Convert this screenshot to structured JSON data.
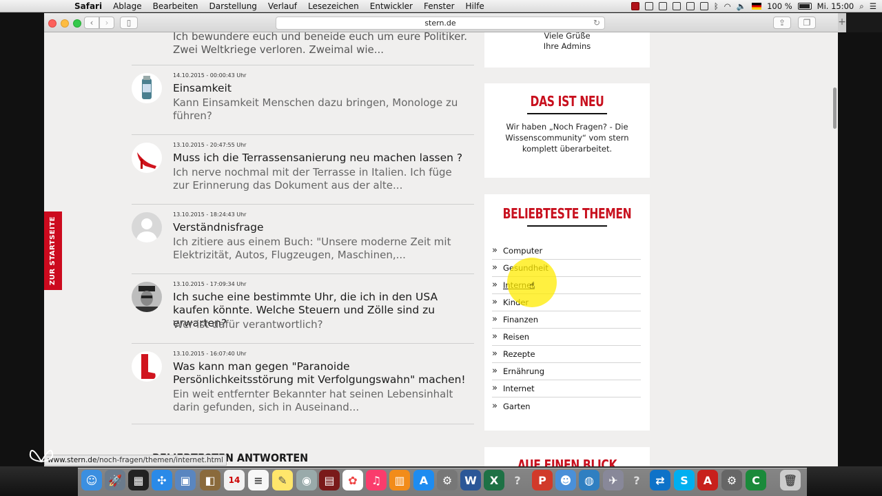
{
  "menubar": {
    "app": "Safari",
    "items": [
      "Ablage",
      "Bearbeiten",
      "Darstellung",
      "Verlauf",
      "Lesezeichen",
      "Entwickler",
      "Fenster",
      "Hilfe"
    ],
    "battery": "100 %",
    "clock": "Mi. 15:00"
  },
  "browser": {
    "url": "stern.de",
    "status_url_prefix": "www.stern.de",
    "status_url_path": "/noch-fragen/themen/internet.html"
  },
  "page": {
    "side_tab": "ZUR STARTSEITE",
    "prev_question_text": "Ich bewundere euch und beneide euch um eure Politiker. Zwei Weltkriege verloren. Zweimal wie...",
    "questions": [
      {
        "meta": "14.10.2015 - 00:00:43 Uhr",
        "title": "Einsamkeit",
        "text": "Kann Einsamkeit Menschen dazu bringen, Monologe zu führen?"
      },
      {
        "meta": "13.10.2015 - 20:47:55 Uhr",
        "title": "Muss ich die Terrassensanierung neu machen lassen ?",
        "text": "Ich nerve nochmal mit der Terrasse in Italien. Ich füge zur Erinnerung das Dokument aus der alte..."
      },
      {
        "meta": "13.10.2015 - 18:24:43 Uhr",
        "title": "Verständnisfrage",
        "text": "Ich zitiere aus einem Buch: \"Unsere moderne Zeit mit Elektrizität, Autos, Flugzeugen, Maschinen,..."
      },
      {
        "meta": "13.10.2015 - 17:09:34 Uhr",
        "title": "Ich suche eine bestimmte Uhr, die ich in den USA kaufen könnte. Welche Steuern und Zölle sind zu erwarten?",
        "text": "Wer ist dafür verantwortlich?"
      },
      {
        "meta": "13.10.2015 - 16:07:40 Uhr",
        "title": "Was kann man gegen \"Paranoide Persönlichkeitsstörung mit Verfolgungswahn\" machen!",
        "text": "Ein weit entfernter Bekannter hat seinen Lebensinhalt darin gefunden, sich in Auseinand..."
      }
    ],
    "admins_box": {
      "line1": "Viele Grüße",
      "line2": "Ihre Admins"
    },
    "neu_box": {
      "heading": "DAS IST NEU",
      "text": "Wir haben „Noch Fragen? - Die Wissenscommunity“ vom stern komplett überarbeitet."
    },
    "themen_box": {
      "heading": "BELIEBTESTE THEMEN",
      "topics": [
        "Computer",
        "Gesundheit",
        "Internet",
        "Kinder",
        "Finanzen",
        "Reisen",
        "Rezepte",
        "Ernährung",
        "Internet",
        "Garten"
      ]
    },
    "blick_heading": "AUF EINEN BLICK",
    "bottom_heading": "BELIEBTESTEN ANTWORTEN"
  }
}
